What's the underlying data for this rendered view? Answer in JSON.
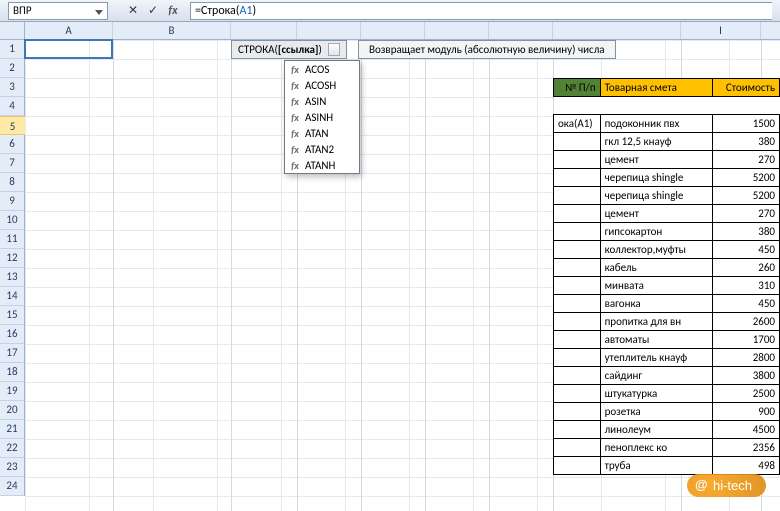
{
  "name_box": "ВПР",
  "formula": {
    "prefix": "=Строка(",
    "ref": "A1",
    "suffix": ")"
  },
  "fn_tip": {
    "name": "СТРОКА",
    "args_open": "(",
    "arg": "[ссылка]",
    "args_close": ")"
  },
  "abs_tip": "Возвращает модуль (абсолютную величину) числа",
  "intelli": [
    "ACOS",
    "ACOSH",
    "ASIN",
    "ASINH",
    "ATAN",
    "ATAN2",
    "ATANH"
  ],
  "columns": [
    "A",
    "B",
    "",
    "",
    "",
    "",
    "",
    "",
    "I"
  ],
  "rows": [
    "1",
    "2",
    "3",
    "4",
    "5",
    "6",
    "7",
    "8",
    "9",
    "10",
    "11",
    "12",
    "13",
    "14",
    "15",
    "16",
    "17",
    "18",
    "19",
    "20",
    "21",
    "22",
    "23",
    "24"
  ],
  "headers": {
    "g": "№ П/п",
    "h": "Товарная смета",
    "i": "Стоимость"
  },
  "g5": "ока(A1)",
  "items": [
    {
      "h": "подоконник пвх",
      "i": "1500"
    },
    {
      "h": "гкл 12,5 кнауф",
      "i": "380"
    },
    {
      "h": "цемент",
      "i": "270"
    },
    {
      "h": "черепица shingle",
      "i": "5200"
    },
    {
      "h": "черепица shingle",
      "i": "5200"
    },
    {
      "h": "цемент",
      "i": "270"
    },
    {
      "h": "гипсокартон",
      "i": "380"
    },
    {
      "h": "коллектор,муфты",
      "i": "450"
    },
    {
      "h": "кабель",
      "i": "260"
    },
    {
      "h": "минвата",
      "i": "310"
    },
    {
      "h": "вагонка",
      "i": "450"
    },
    {
      "h": "пропитка для вн",
      "i": "2600"
    },
    {
      "h": "автоматы",
      "i": "1700"
    },
    {
      "h": "утеплитель кнауф",
      "i": "2800"
    },
    {
      "h": "сайдинг",
      "i": "3800"
    },
    {
      "h": "штукатурка",
      "i": "2500"
    },
    {
      "h": "розетка",
      "i": "900"
    },
    {
      "h": "линолеум",
      "i": "4500"
    },
    {
      "h": "пеноплекс ко",
      "i": "2356"
    },
    {
      "h": "труба",
      "i": "498"
    }
  ],
  "watermark": "hi-tech"
}
